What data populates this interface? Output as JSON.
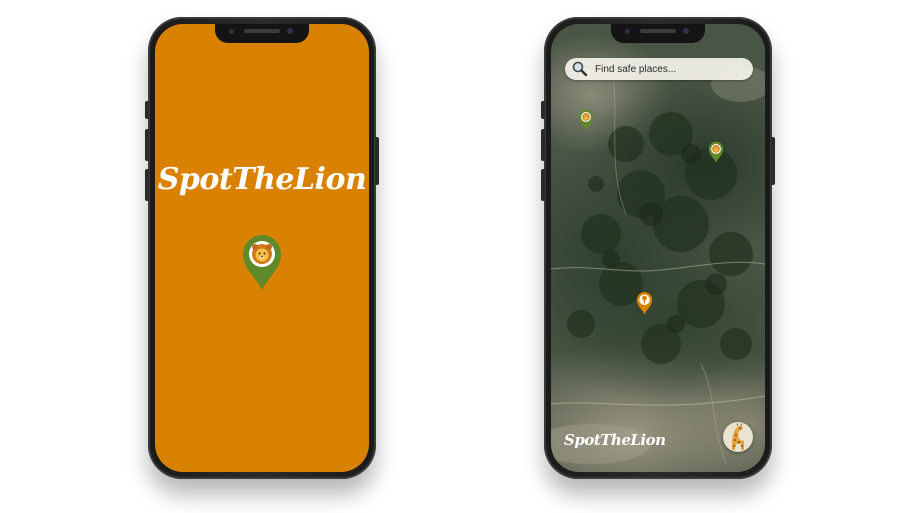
{
  "splash_screen": {
    "title": "SpotTheLion",
    "background_color": "#d98100",
    "pin_color": "#5f8a2a",
    "icon": "lion-icon"
  },
  "map_screen": {
    "search": {
      "placeholder": "Find safe places...",
      "icon": "search-icon"
    },
    "brand": "SpotTheLion",
    "markers": [
      {
        "type": "lion",
        "color": "#5f8a2a"
      },
      {
        "type": "lion",
        "color": "#5f8a2a"
      },
      {
        "type": "tree",
        "color": "#d98100"
      }
    ],
    "giraffe_button": {
      "icon": "giraffe-icon"
    }
  }
}
